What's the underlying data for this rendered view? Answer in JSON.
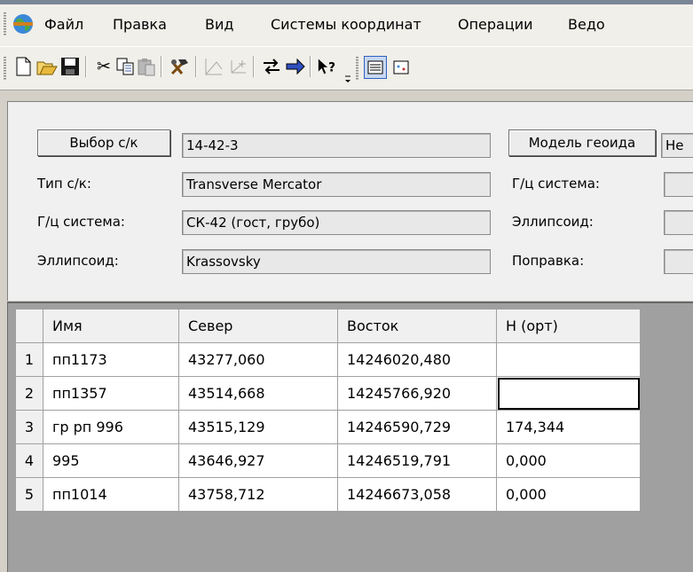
{
  "menu": [
    "Файл",
    "Правка",
    "Вид",
    "Системы координат",
    "Операции",
    "Ведо"
  ],
  "toolbar": {
    "icons": [
      "new-icon",
      "open-icon",
      "save-icon",
      "cut-icon",
      "copy-icon",
      "paste-icon",
      "tools-icon",
      "geometry-icon",
      "axes-icon",
      "swap-icon",
      "transform-icon",
      "help-icon",
      "list-view-icon",
      "map-view-icon"
    ]
  },
  "panel": {
    "select_cs_button": "Выбор с/к",
    "cs_name": "14-42-3",
    "cs_type_label": "Тип с/к:",
    "cs_type_value": "Transverse Mercator",
    "geodetic_label": "Г/ц система:",
    "geodetic_value": "СК-42 (гост, грубо)",
    "ellipsoid_label": "Эллипсоид:",
    "ellipsoid_value": "Krassovsky",
    "geoid_button": "Модель геоида",
    "geoid_value": "Не",
    "right_geodetic_label": "Г/ц система:",
    "right_ellipsoid_label": "Эллипсоид:",
    "correction_label": "Поправка:"
  },
  "grid": {
    "columns": [
      "Имя",
      "Север",
      "Восток",
      "Н (орт)"
    ],
    "rows": [
      {
        "num": "1",
        "name": "пп1173",
        "north": "43277,060",
        "east": "14246020,480",
        "h": ""
      },
      {
        "num": "2",
        "name": "пп1357",
        "north": "43514,668",
        "east": "14245766,920",
        "h": ""
      },
      {
        "num": "3",
        "name": "гр рп 996",
        "north": "43515,129",
        "east": "14246590,729",
        "h": "174,344"
      },
      {
        "num": "4",
        "name": "995",
        "north": "43646,927",
        "east": "14246519,791",
        "h": "0,000"
      },
      {
        "num": "5",
        "name": "пп1014",
        "north": "43758,712",
        "east": "14246673,058",
        "h": "0,000"
      }
    ]
  }
}
